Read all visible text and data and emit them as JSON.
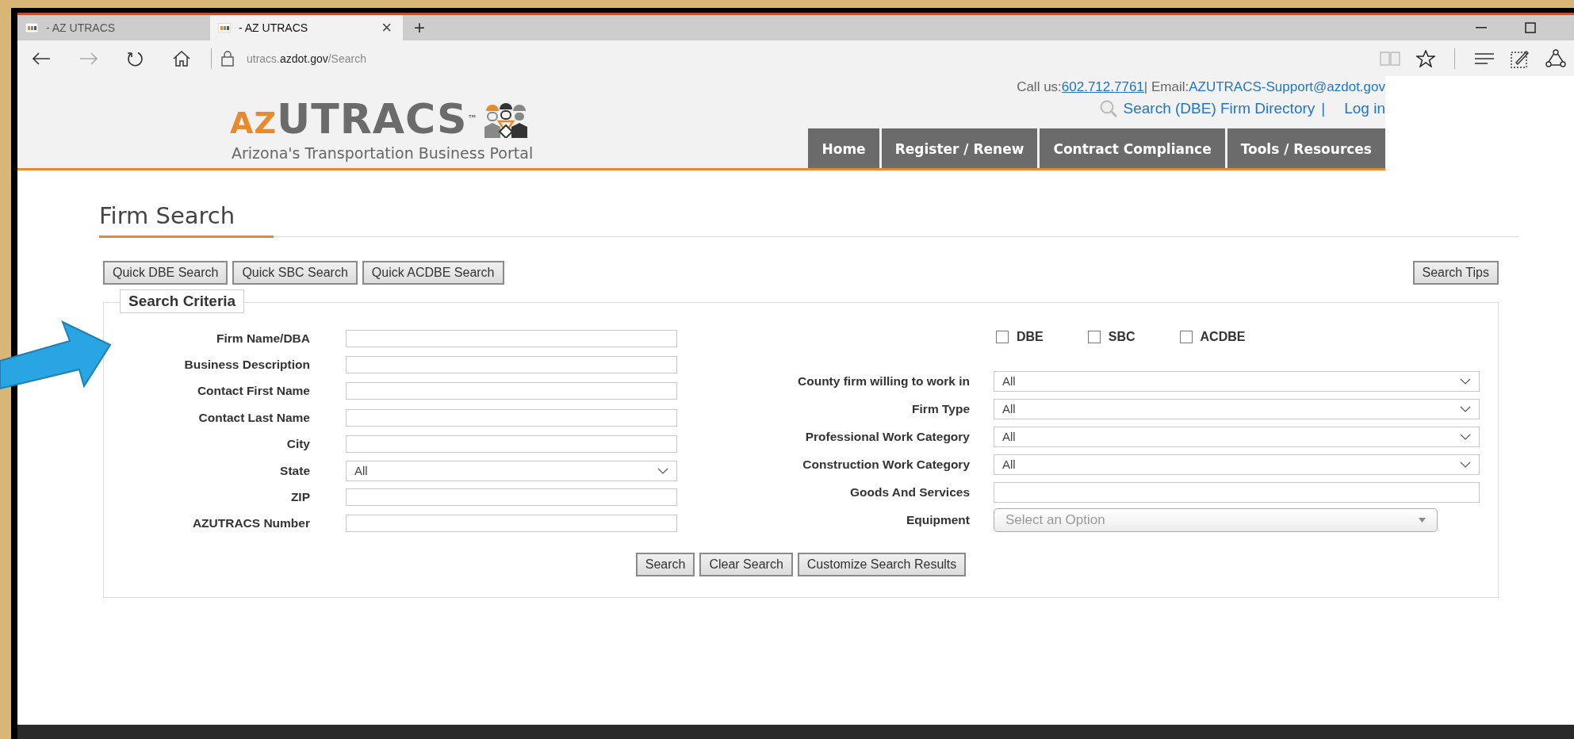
{
  "browser": {
    "tabs": [
      {
        "title": "- AZ UTRACS",
        "selected": false
      },
      {
        "title": "- AZ UTRACS",
        "selected": true
      }
    ],
    "close_tab": "×",
    "new_tab": "+",
    "url_host": "utracs.",
    "url_domain": "azdot.gov",
    "url_path": "/Search"
  },
  "contact": {
    "call_label": "Call us:",
    "phone": "602.712.7761",
    "separator": "| Email:",
    "email": "AZUTRACS-Support@azdot.gov"
  },
  "logo": {
    "prefix": "AZ",
    "name": "UTRACS",
    "trademark": "™",
    "tagline": "Arizona's Transportation Business Portal"
  },
  "header_links": [
    {
      "label": "Search (DBE) Firm Directory"
    },
    {
      "label": "Log in"
    }
  ],
  "header_separator": "|",
  "nav": [
    {
      "label": "Home",
      "selected": false
    },
    {
      "label": "Register / Renew",
      "selected": false
    },
    {
      "label": "Contract Compliance",
      "selected": false
    },
    {
      "label": "Tools / Resources",
      "selected": false
    }
  ],
  "page_title": "Firm Search",
  "quick_buttons": [
    "Quick DBE Search",
    "Quick SBC Search",
    "Quick ACDBE Search"
  ],
  "search_tips": "Search Tips",
  "criteria": {
    "legend": "Search Criteria",
    "left_fields": [
      {
        "label": "Firm Name/DBA",
        "kind": "text"
      },
      {
        "label": "Business Description",
        "kind": "text"
      },
      {
        "label": "Contact First Name",
        "kind": "text"
      },
      {
        "label": "Contact Last Name",
        "kind": "text"
      },
      {
        "label": "City",
        "kind": "text"
      },
      {
        "label": "State",
        "kind": "select",
        "value": "All"
      },
      {
        "label": "ZIP",
        "kind": "text"
      },
      {
        "label": "AZUTRACS Number",
        "kind": "text"
      }
    ],
    "checkboxes": [
      {
        "label": "DBE",
        "checked": false
      },
      {
        "label": "SBC",
        "checked": false
      },
      {
        "label": "ACDBE",
        "checked": false
      }
    ],
    "right_fields": [
      {
        "label": "County firm willing to work in",
        "kind": "select",
        "value": "All"
      },
      {
        "label": "Firm Type",
        "kind": "select",
        "value": "All"
      },
      {
        "label": "Professional Work Category",
        "kind": "select",
        "value": "All"
      },
      {
        "label": "Construction Work Category",
        "kind": "select",
        "value": "All"
      },
      {
        "label": "Goods And Services",
        "kind": "text"
      },
      {
        "label": "Equipment",
        "kind": "combo",
        "placeholder": "Select an Option"
      }
    ],
    "buttons": [
      "Search",
      "Clear Search",
      "Customize Search Results"
    ]
  }
}
